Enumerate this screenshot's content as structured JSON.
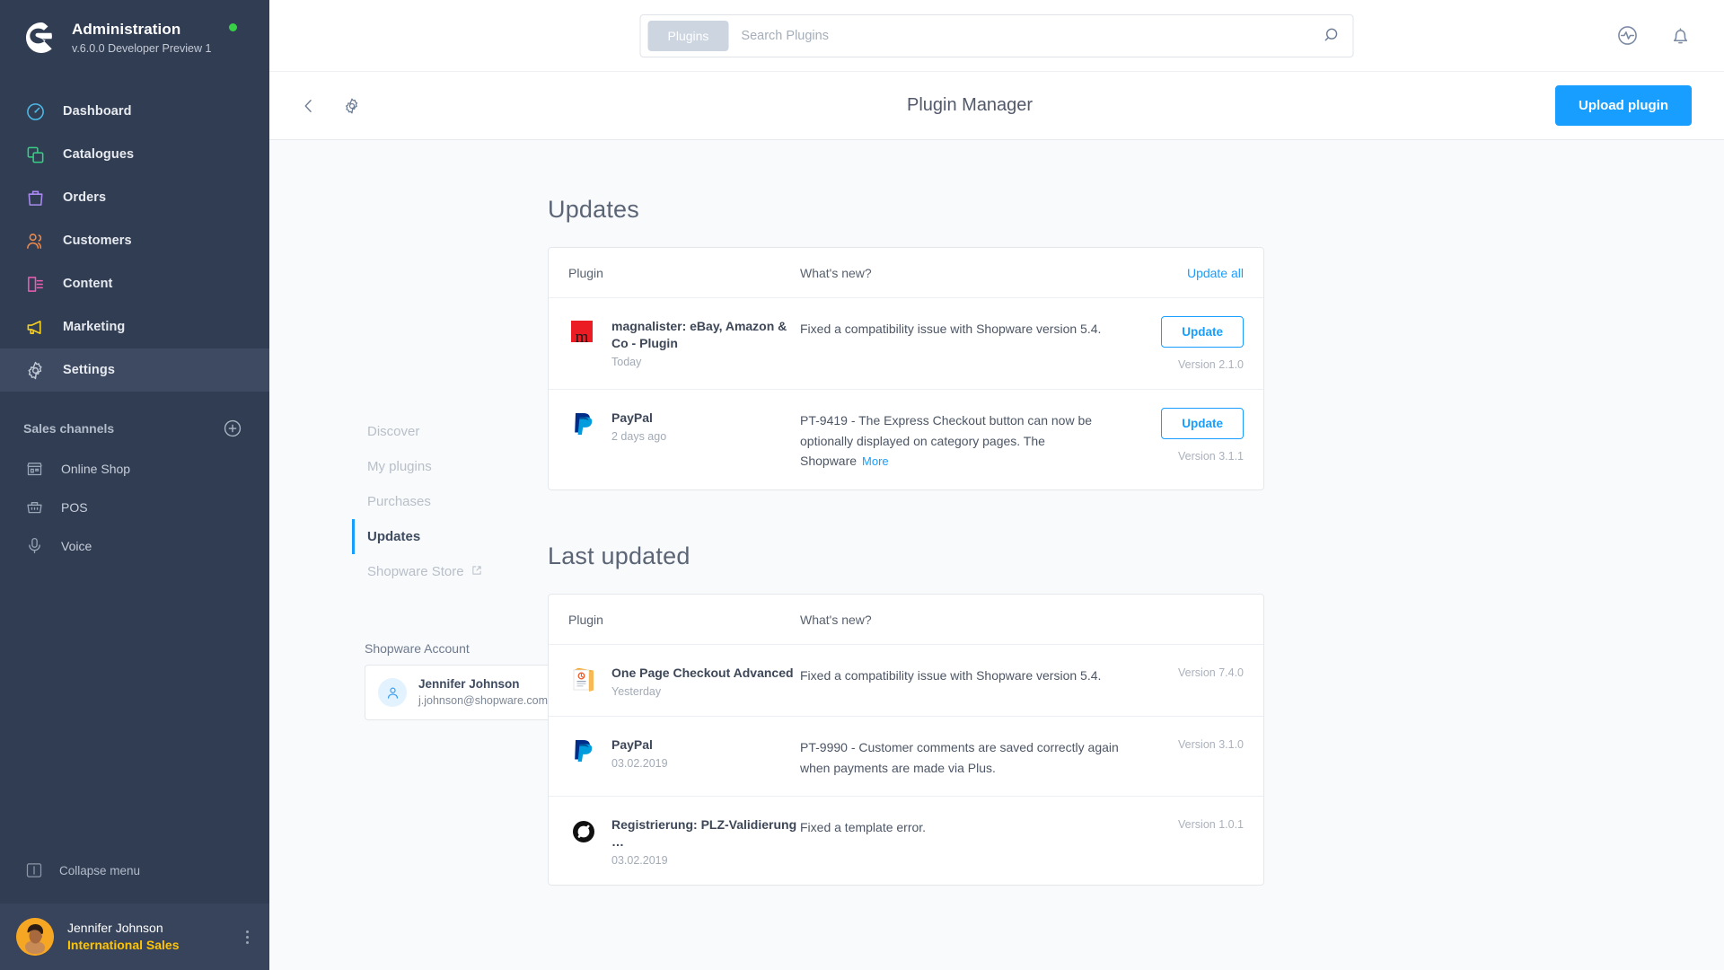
{
  "sidebar": {
    "brand": {
      "title": "Administration",
      "version": "v.6.0.0 Developer Preview 1",
      "status_color": "#37d046"
    },
    "nav": [
      {
        "label": "Dashboard",
        "icon": "speedometer-icon",
        "color": "#4dbbe8"
      },
      {
        "label": "Catalogues",
        "icon": "copy-icon",
        "color": "#37d183"
      },
      {
        "label": "Orders",
        "icon": "bag-icon",
        "color": "#a98bf0"
      },
      {
        "label": "Customers",
        "icon": "users-icon",
        "color": "#f08a4b"
      },
      {
        "label": "Content",
        "icon": "content-icon",
        "color": "#ef5db1"
      },
      {
        "label": "Marketing",
        "icon": "megaphone-icon",
        "color": "#f5d022"
      },
      {
        "label": "Settings",
        "icon": "gear-icon",
        "color": "#aab4c4",
        "active": true
      }
    ],
    "sales_channels_title": "Sales channels",
    "channels": [
      {
        "label": "Online Shop",
        "icon": "storefront-icon"
      },
      {
        "label": "POS",
        "icon": "basket-icon"
      },
      {
        "label": "Voice",
        "icon": "microphone-icon"
      }
    ],
    "collapse_label": "Collapse menu",
    "profile": {
      "name": "Jennifer Johnson",
      "role": "International Sales",
      "role_color": "#ffc400"
    }
  },
  "topbar": {
    "search_scope": "Plugins",
    "search_value": "",
    "search_placeholder": "Search Plugins",
    "icons": [
      "activity-icon",
      "bell-icon"
    ]
  },
  "pagehead": {
    "title": "Plugin Manager",
    "upload_label": "Upload plugin",
    "accent": "#189eff"
  },
  "subnav": {
    "items": [
      {
        "label": "Discover",
        "active": false,
        "external": false
      },
      {
        "label": "My plugins",
        "active": false,
        "external": false
      },
      {
        "label": "Purchases",
        "active": false,
        "external": false
      },
      {
        "label": "Updates",
        "active": true,
        "external": false
      },
      {
        "label": "Shopware Store",
        "active": false,
        "external": true
      }
    ]
  },
  "account": {
    "label": "Shopware Account",
    "name": "Jennifer Johnson",
    "email": "j.johnson@shopware.com"
  },
  "updates": {
    "title": "Updates",
    "col_plugin": "Plugin",
    "col_new": "What's new?",
    "update_all": "Update all",
    "rows": [
      {
        "name": "magnalister: eBay, Amazon & Co - Plugin",
        "date": "Today",
        "logo": "magnalister-logo",
        "text": "Fixed a compatibility issue with Shopware version 5.4.",
        "more": "",
        "button": "Update",
        "version": "Version 2.1.0"
      },
      {
        "name": "PayPal",
        "date": "2 days ago",
        "logo": "paypal-logo",
        "text": "PT-9419 - The Express Checkout button can now be optionally displayed on category pages. The Shopware",
        "more": "More",
        "button": "Update",
        "version": "Version 3.1.1"
      }
    ]
  },
  "last_updated": {
    "title": "Last updated",
    "col_plugin": "Plugin",
    "col_new": "What's new?",
    "rows": [
      {
        "name": "One Page Checkout Advanced",
        "date": "Yesterday",
        "logo": "onepagecheckout-logo",
        "text": "Fixed a compatibility issue with Shopware version 5.4.",
        "version": "Version 7.4.0"
      },
      {
        "name": "PayPal",
        "date": "03.02.2019",
        "logo": "paypal-logo",
        "text": "PT-9990 - Customer comments are saved correctly again when payments are made via Plus.",
        "version": "Version 3.1.0"
      },
      {
        "name": "Registrierung: PLZ-Validierung …",
        "date": "03.02.2019",
        "logo": "blocked-logo",
        "text": "Fixed a template error.",
        "version": "Version 1.0.1"
      }
    ]
  }
}
